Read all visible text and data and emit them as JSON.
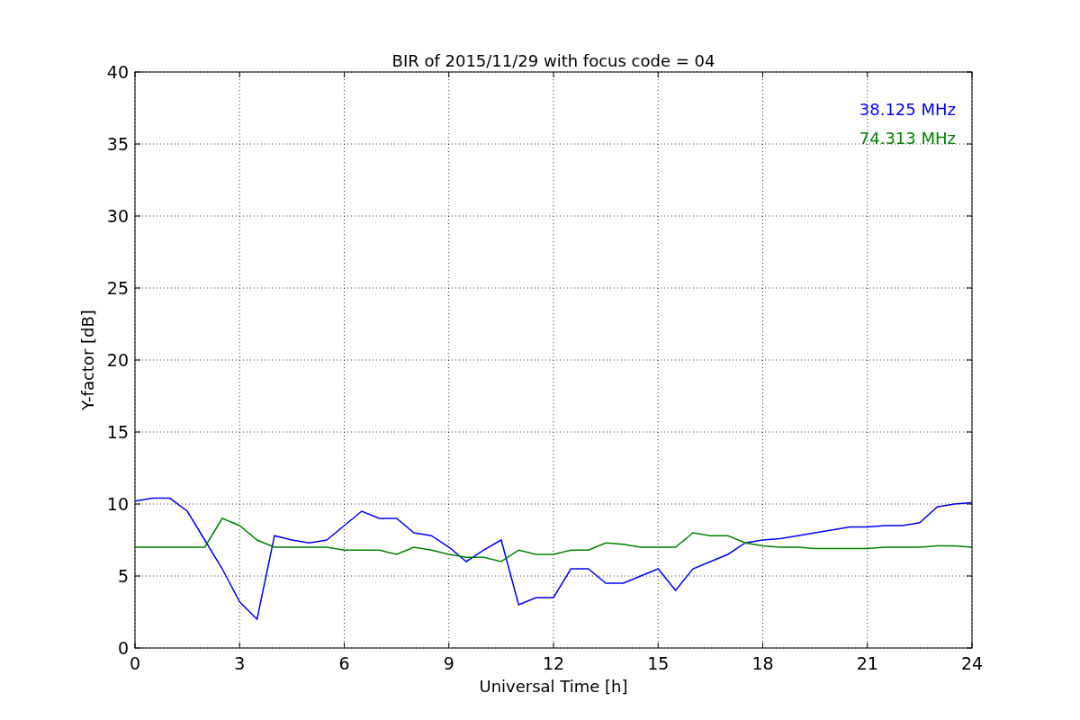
{
  "figure": {
    "chart_data": {
      "type": "line",
      "title": "BIR of 2015/11/29 with focus code = 04",
      "xlabel": "Universal Time [h]",
      "ylabel": "Y-factor [dB]",
      "x": [
        0,
        0.5,
        1,
        1.5,
        2,
        2.5,
        3,
        3.5,
        4,
        4.5,
        5,
        5.5,
        6,
        6.5,
        7,
        7.5,
        8,
        8.5,
        9,
        9.5,
        10,
        10.5,
        11,
        11.5,
        12,
        12.5,
        13,
        13.5,
        14,
        14.5,
        15,
        15.5,
        16,
        16.5,
        17,
        17.5,
        18,
        18.5,
        19,
        19.5,
        20,
        20.5,
        21,
        21.5,
        22,
        22.5,
        23,
        23.5,
        24
      ],
      "series": [
        {
          "name": "38.125 MHz",
          "color": "#0000ff",
          "values": [
            10.2,
            10.4,
            10.4,
            9.5,
            7.5,
            5.5,
            3.2,
            2,
            7.8,
            7.5,
            7.3,
            7.5,
            8.5,
            9.5,
            9,
            9,
            8,
            7.8,
            7,
            6,
            6.8,
            7.5,
            3,
            3.5,
            3.5,
            5.5,
            5.5,
            4.5,
            4.5,
            5,
            5.5,
            4,
            5.5,
            6,
            6.5,
            7.3,
            7.5,
            7.6,
            7.8,
            8,
            8.2,
            8.4,
            8.4,
            8.5,
            8.5,
            8.7,
            9.8,
            10,
            10.1
          ]
        },
        {
          "name": "74.313 MHz",
          "color": "#008000",
          "values": [
            7,
            7,
            7,
            7,
            7,
            9,
            8.5,
            7.5,
            7,
            7,
            7,
            7,
            6.8,
            6.8,
            6.8,
            6.5,
            7,
            6.8,
            6.5,
            6.3,
            6.3,
            6,
            6.8,
            6.5,
            6.5,
            6.8,
            6.8,
            7.3,
            7.2,
            7,
            7,
            7,
            8,
            7.8,
            7.8,
            7.3,
            7.1,
            7,
            7,
            6.9,
            6.9,
            6.9,
            6.9,
            7,
            7,
            7,
            7.1,
            7.1,
            7
          ]
        }
      ],
      "grid": true,
      "xlim": [
        0,
        24
      ],
      "ylim": [
        0,
        40
      ],
      "xticks": [
        0,
        3,
        6,
        9,
        12,
        15,
        18,
        21,
        24
      ],
      "yticks": [
        0,
        5,
        10,
        15,
        20,
        25,
        30,
        35,
        40
      ]
    }
  }
}
